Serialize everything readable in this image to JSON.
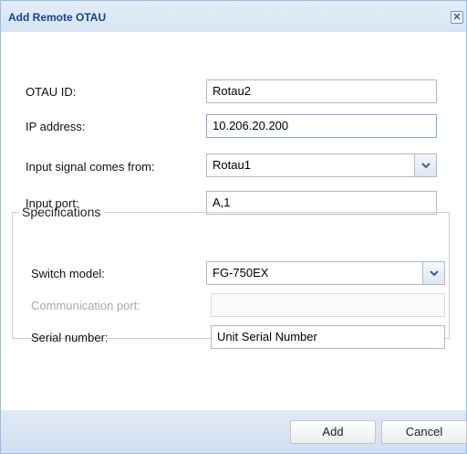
{
  "dialog": {
    "title": "Add Remote OTAU",
    "close_icon": "close-icon"
  },
  "form": {
    "otau_id": {
      "label": "OTAU ID:",
      "value": "Rotau2"
    },
    "ip_address": {
      "label": "IP address:",
      "value": "10.206.20.200"
    },
    "input_signal": {
      "label": "Input signal comes from:",
      "value": "Rotau1"
    },
    "input_port": {
      "label": "Input port:",
      "value": "A,1"
    }
  },
  "specifications": {
    "legend": "Specifications",
    "switch_model": {
      "label": "Switch model:",
      "value": "FG-750EX"
    },
    "communication_port": {
      "label": "Communication port:",
      "value": ""
    },
    "serial_number": {
      "label": "Serial number:",
      "value": "Unit Serial Number"
    }
  },
  "buttons": {
    "add": "Add",
    "cancel": "Cancel"
  },
  "colors": {
    "title_text": "#15428b",
    "frame_border": "#99bbe8",
    "footer_bg": "#d3e0f1"
  }
}
